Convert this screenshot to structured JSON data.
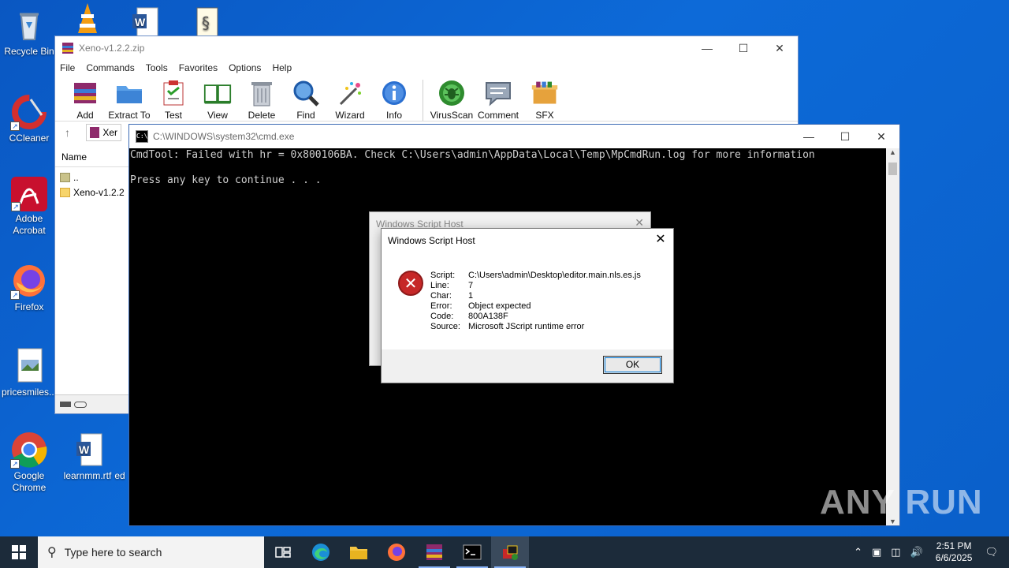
{
  "desktop": {
    "icons": [
      {
        "label": "Recycle Bin"
      },
      {
        "label": "CCleaner"
      },
      {
        "label": "Adobe Acrobat"
      },
      {
        "label": "Firefox"
      },
      {
        "label": "pricesmiles..."
      },
      {
        "label": "Google Chrome"
      },
      {
        "label": "learnmm.rtf"
      },
      {
        "label": "ed"
      }
    ]
  },
  "winrar": {
    "title": "Xeno-v1.2.2.zip",
    "menu": [
      "File",
      "Commands",
      "Tools",
      "Favorites",
      "Options",
      "Help"
    ],
    "toolbar": [
      "Add",
      "Extract To",
      "Test",
      "View",
      "Delete",
      "Find",
      "Wizard",
      "Info",
      "VirusScan",
      "Comment",
      "SFX"
    ],
    "address_fragment": "Xer",
    "column_name": "Name",
    "rows": [
      "..",
      "Xeno-v1.2.2"
    ]
  },
  "cmd": {
    "title": "C:\\WINDOWS\\system32\\cmd.exe",
    "line1": "CmdTool: Failed with hr = 0x800106BA. Check C:\\Users\\admin\\AppData\\Local\\Temp\\MpCmdRun.log for more information",
    "line2": "Press any key to continue . . ."
  },
  "dialog_back": {
    "title": "Windows Script Host"
  },
  "dialog": {
    "title": "Windows Script Host",
    "fields": [
      {
        "k": "Script:",
        "v": "C:\\Users\\admin\\Desktop\\editor.main.nls.es.js"
      },
      {
        "k": "Line:",
        "v": "7"
      },
      {
        "k": "Char:",
        "v": "1"
      },
      {
        "k": "Error:",
        "v": "Object expected"
      },
      {
        "k": "Code:",
        "v": "800A138F"
      },
      {
        "k": "Source:",
        "v": "Microsoft JScript runtime error"
      }
    ],
    "ok_label": "OK"
  },
  "taskbar": {
    "search_placeholder": "Type here to search",
    "time": "2:51 PM",
    "date": "6/6/2025"
  },
  "watermark": "ANY RUN"
}
